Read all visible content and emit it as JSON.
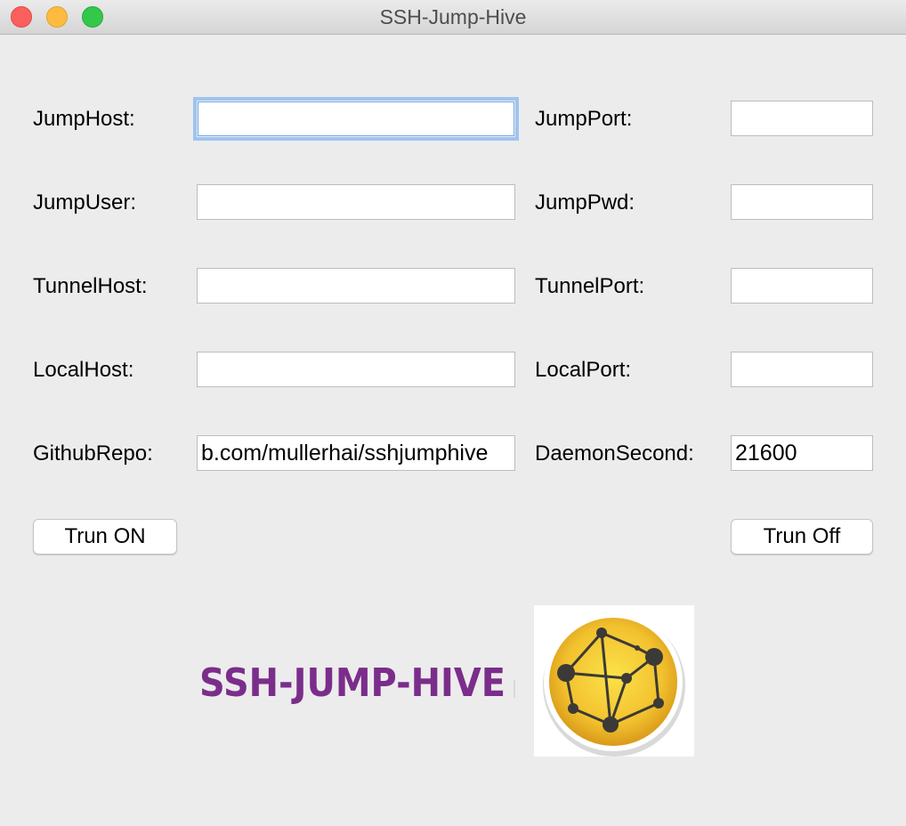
{
  "window": {
    "title": "SSH-Jump-Hive"
  },
  "form": {
    "jump_host_label": "JumpHost:",
    "jump_host_value": "",
    "jump_port_label": "JumpPort:",
    "jump_port_value": "",
    "jump_user_label": "JumpUser:",
    "jump_user_value": "",
    "jump_pwd_label": "JumpPwd:",
    "jump_pwd_value": "",
    "tunnel_host_label": "TunnelHost:",
    "tunnel_host_value": "",
    "tunnel_port_label": "TunnelPort:",
    "tunnel_port_value": "",
    "local_host_label": "LocalHost:",
    "local_host_value": "",
    "local_port_label": "LocalPort:",
    "local_port_value": "",
    "github_repo_label": "GithubRepo:",
    "github_repo_value": "b.com/mullerhai/sshjumphive",
    "daemon_second_label": "DaemonSecond:",
    "daemon_second_value": "21600"
  },
  "buttons": {
    "turn_on": "Trun ON",
    "turn_off": "Trun Off"
  },
  "logo": {
    "text": "SSH-JUMP-HIVE",
    "text_color": "#7b2d8b",
    "icon_name": "network-graph-icon",
    "icon_color": "#f2c12e"
  }
}
